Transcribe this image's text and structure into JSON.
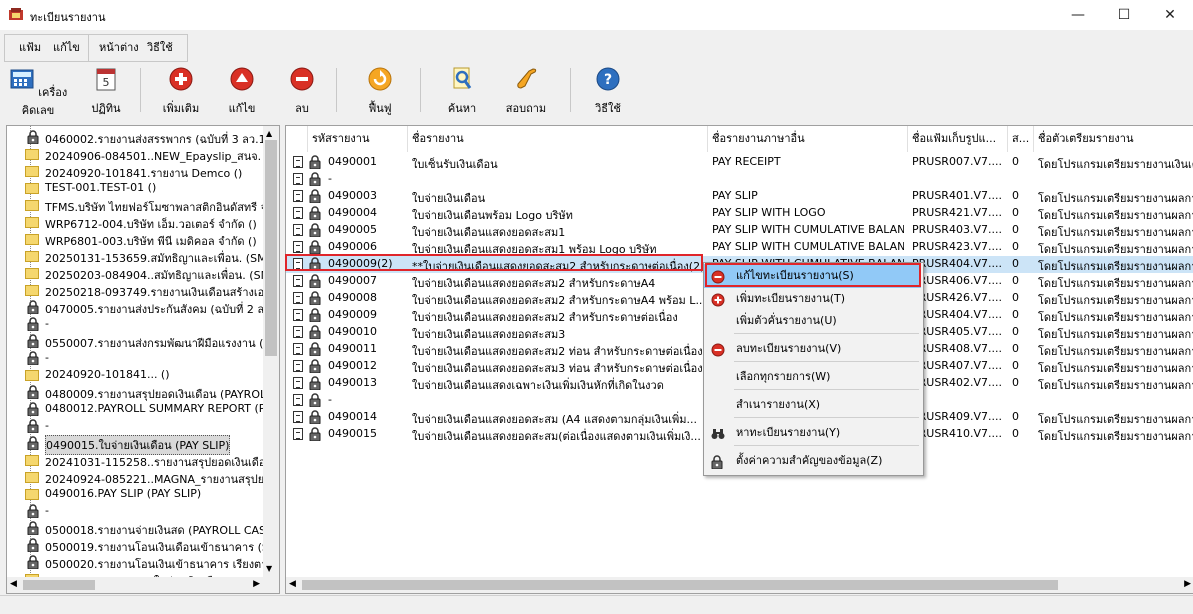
{
  "window": {
    "title": "ทะเบียนรายงาน",
    "minimize": "—",
    "maximize": "☐",
    "close": "✕"
  },
  "menu": {
    "file": "แฟ้ม",
    "edit": "แก้ไข",
    "window": "หน้าต่าง",
    "help": "วิธีใช้"
  },
  "toolbar": {
    "calculator": "เครื่องคิดเลข",
    "calendar": "ปฏิทิน",
    "add": "เพิ่มเติม",
    "edit": "แก้ไข",
    "delete": "ลบ",
    "restore": "ฟื้นฟู",
    "search": "ค้นหา",
    "inquiry": "สอบถาม",
    "help": "วิธีใช้",
    "calendar_digit": "5"
  },
  "tree": [
    {
      "type": "lock",
      "label": "0460002.รายงานส่งสรรพากร (ฉบับที่ 3 ลว.11/1"
    },
    {
      "type": "folder",
      "label": "20240906-084501..NEW_Epayslip_สนจ. บริษ"
    },
    {
      "type": "folder",
      "label": "20240920-101841.รายงาน Demco ()"
    },
    {
      "type": "folder",
      "label": "TEST-001.TEST-01 ()"
    },
    {
      "type": "folder",
      "label": "TFMS.บริษัท ไทยฟอร์โมซาพลาสติกอินดัสทรี จำ"
    },
    {
      "type": "folder",
      "label": "WRP6712-004.บริษัท เอ็ม.วอเตอร์ จำกัด ()"
    },
    {
      "type": "folder",
      "label": "WRP6801-003.บริษัท พีนี เมดิคอล จำกัด ()"
    },
    {
      "type": "folder",
      "label": "20250131-153659.สมัทธิญาและเพื่อน. (SMI"
    },
    {
      "type": "folder",
      "label": "20250203-084904..สมัทธิญาและเพื่อน. (SMI"
    },
    {
      "type": "folder",
      "label": "20250218-093749.รายงานเงินเดือนสร้างเองเพี"
    },
    {
      "type": "lock",
      "label": "0470005.รายงานส่งประกันสังคม (ฉบับที่ 2 ลว.2"
    },
    {
      "type": "lock",
      "label": "-"
    },
    {
      "type": "lock",
      "label": "0550007.รายงานส่งกรมพัฒนาฝีมือแรงงาน (DEV"
    },
    {
      "type": "lock",
      "label": "-"
    },
    {
      "type": "folder",
      "label": "20240920-101841... ()"
    },
    {
      "type": "lock",
      "label": "0480009.รายงานสรุปยอดเงินเดือน (PAYROLL S"
    },
    {
      "type": "lock",
      "label": "0480012.PAYROLL SUMMARY REPORT (PAYR"
    },
    {
      "type": "lock",
      "label": "-"
    },
    {
      "type": "lock",
      "label": "0490015.ใบจ่ายเงินเดือน (PAY SLIP)",
      "selected": true
    },
    {
      "type": "folder",
      "label": "20241031-115258..รายงานสรุปยอดเงินเดือน. ("
    },
    {
      "type": "folder",
      "label": "20240924-085221..MAGNA_รายงานสรุปยอดเง"
    },
    {
      "type": "folder",
      "label": "0490016.PAY SLIP (PAY SLIP)"
    },
    {
      "type": "lock",
      "label": "-"
    },
    {
      "type": "lock",
      "label": "0500018.รายงานจ่ายเงินสด (PAYROLL CASH P"
    },
    {
      "type": "lock",
      "label": "0500019.รายงานโอนเงินเดือนเข้าธนาคาร (SAL"
    },
    {
      "type": "lock",
      "label": "0500020.รายงานโอนเงินเข้าธนาคาร เรียงตามรหั"
    },
    {
      "type": "folder",
      "label": "20241129-172106..ใบจ่ายเงินเดือน. (PAY SLIP"
    },
    {
      "type": "lock",
      "label": "0500021.รายงานโอนเงินเดือนเข้าธนาคาร (ภาษ"
    }
  ],
  "columns": [
    "รหัสรายงาน",
    "ชื่อรายงาน",
    "ชื่อรายงานภาษาอื่น",
    "ชื่อแฟ้มเก็บรูปแ...",
    "ส...",
    "ชื่อตัวเตรียมรายงาน"
  ],
  "rows": [
    {
      "code": "0490001",
      "name": "ใบเซ็นรับเงินเดือน",
      "other": "PAY RECEIPT",
      "file": "PRUSR007.V7....",
      "s": "0",
      "prep": "โดยโปรแกรมเตรียมรายงานเงินเดือ"
    },
    {
      "code": "-",
      "name": "",
      "other": "",
      "file": "",
      "s": "",
      "prep": ""
    },
    {
      "code": "0490003",
      "name": "ใบจ่ายเงินเดือน",
      "other": "PAY SLIP",
      "file": "PRUSR401.V7....",
      "s": "0",
      "prep": "โดยโปรแกรมเตรียมรายงานผลการ"
    },
    {
      "code": "0490004",
      "name": "ใบจ่ายเงินเดือนพร้อม Logo บริษัท",
      "other": "PAY SLIP WITH LOGO",
      "file": "PRUSR421.V7....",
      "s": "0",
      "prep": "โดยโปรแกรมเตรียมรายงานผลการ"
    },
    {
      "code": "0490005",
      "name": "ใบจ่ายเงินเดือนแสดงยอดสะสม1",
      "other": "PAY SLIP WITH CUMULATIVE BALAN...",
      "file": "PRUSR403.V7....",
      "s": "0",
      "prep": "โดยโปรแกรมเตรียมรายงานผลการ"
    },
    {
      "code": "0490006",
      "name": "ใบจ่ายเงินเดือนแสดงยอดสะสม1 พร้อม Logo บริษัท",
      "other": "PAY SLIP WITH CUMULATIVE BALAN...",
      "file": "PRUSR423.V7....",
      "s": "0",
      "prep": "โดยโปรแกรมเตรียมรายงานผลการ"
    },
    {
      "code": "0490009(2)",
      "name": "**ใบจ่ายเงินเดือนแสดงยอดสะสม2 สำหรับกระดาษต่อเนื่อง(2)",
      "other": "PAY SLIP WITH CUMULATIVE BALAN...",
      "file": "PRUSR404.V7....",
      "s": "0",
      "prep": "โดยโปรแกรมเตรียมรายงานผลการ",
      "selected": true
    },
    {
      "code": "0490007",
      "name": "ใบจ่ายเงินเดือนแสดงยอดสะสม2 สำหรับกระดาษA4",
      "other": "",
      "file": "PRUSR406.V7....",
      "s": "0",
      "prep": "โดยโปรแกรมเตรียมรายงานผลการ"
    },
    {
      "code": "0490008",
      "name": "ใบจ่ายเงินเดือนแสดงยอดสะสม2 สำหรับกระดาษA4 พร้อม L...",
      "other": "",
      "file": "PRUSR426.V7....",
      "s": "0",
      "prep": "โดยโปรแกรมเตรียมรายงานผลการ"
    },
    {
      "code": "0490009",
      "name": "ใบจ่ายเงินเดือนแสดงยอดสะสม2 สำหรับกระดาษต่อเนื่อง",
      "other": "",
      "file": "PRUSR404.V7....",
      "s": "0",
      "prep": "โดยโปรแกรมเตรียมรายงานผลการ"
    },
    {
      "code": "0490010",
      "name": "ใบจ่ายเงินเดือนแสดงยอดสะสม3",
      "other": "",
      "file": "PRUSR405.V7....",
      "s": "0",
      "prep": "โดยโปรแกรมเตรียมรายงานผลการ"
    },
    {
      "code": "0490011",
      "name": "ใบจ่ายเงินเดือนแสดงยอดสะสม2 ท่อน สำหรับกระดาษต่อเนื่อง",
      "other": "",
      "file": "PRUSR408.V7....",
      "s": "0",
      "prep": "โดยโปรแกรมเตรียมรายงานผลการ"
    },
    {
      "code": "0490012",
      "name": "ใบจ่ายเงินเดือนแสดงยอดสะสม3 ท่อน สำหรับกระดาษต่อเนื่อง",
      "other": "",
      "file": "PRUSR407.V7....",
      "s": "0",
      "prep": "โดยโปรแกรมเตรียมรายงานผลการ"
    },
    {
      "code": "0490013",
      "name": "ใบจ่ายเงินเดือนแสดงเฉพาะเงินเพิ่มเงินหักที่เกิดในงวด",
      "other": "",
      "file": "PRUSR402.V7....",
      "s": "0",
      "prep": "โดยโปรแกรมเตรียมรายงานผลการ"
    },
    {
      "code": "-",
      "name": "",
      "other": "",
      "file": "",
      "s": "",
      "prep": ""
    },
    {
      "code": "0490014",
      "name": "ใบจ่ายเงินเดือนแสดงยอดสะสม (A4 แสดงตามกลุ่มเงินเพิ่ม...",
      "other": "",
      "file": "PRUSR409.V7....",
      "s": "0",
      "prep": "โดยโปรแกรมเตรียมรายงานผลการ"
    },
    {
      "code": "0490015",
      "name": "ใบจ่ายเงินเดือนแสดงยอดสะสม(ต่อเนื่องแสดงตามเงินเพิ่มเงิ...",
      "other": "",
      "file": "PRUSR410.V7....",
      "s": "0",
      "prep": "โดยโปรแกรมเตรียมรายงานผลการ"
    }
  ],
  "context_menu": [
    {
      "label": "แก้ไขทะเบียนรายงาน(S)",
      "icon": "minus-circle-icon",
      "highlighted": true
    },
    {
      "label": "เพิ่มทะเบียนรายงาน(T)",
      "icon": "plus-circle-icon"
    },
    {
      "label": "เพิ่มตัวคั่นรายงาน(U)",
      "icon": ""
    },
    {
      "label": "ลบทะเบียนรายงาน(V)",
      "icon": "minus-circle-icon"
    },
    {
      "label": "เลือกทุกรายการ(W)",
      "icon": ""
    },
    {
      "label": "สำเนารายงาน(X)",
      "icon": ""
    },
    {
      "label": "หาทะเบียนรายงาน(Y)",
      "icon": "binoculars-icon"
    },
    {
      "label": "ตั้งค่าความสำคัญของข้อมูล(Z)",
      "icon": "lock-icon"
    }
  ],
  "colors": {
    "accent_red": "#e0252a",
    "selection": "#cce4f7",
    "menu_highlight": "#91c9f7"
  }
}
